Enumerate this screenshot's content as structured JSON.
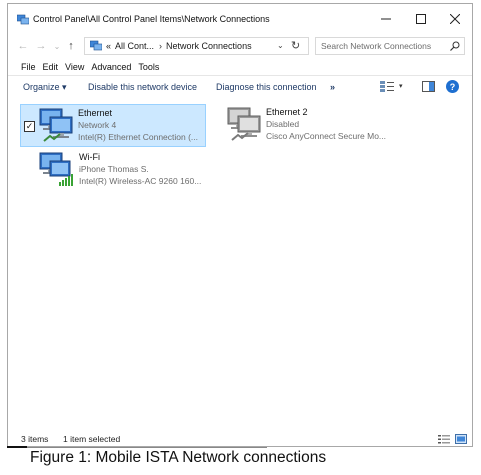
{
  "window": {
    "title": "Control Panel\\All Control Panel Items\\Network Connections",
    "controls": {
      "minimize": "─",
      "maximize": "☐",
      "close": "✕"
    }
  },
  "address": {
    "nav": {
      "back": "←",
      "forward": "→",
      "recent": "⌄",
      "up": "↑"
    },
    "crumb_overflow": "«",
    "crumbs": [
      "All Cont...",
      "Network Connections"
    ],
    "separator": "›",
    "dropdown": "⌄",
    "refresh": "↻"
  },
  "search": {
    "placeholder": "Search Network Connections"
  },
  "menu": {
    "items": [
      "File",
      "Edit",
      "View",
      "Advanced",
      "Tools"
    ]
  },
  "commands": {
    "organize": "Organize ▾",
    "disable": "Disable this network device",
    "diagnose": "Diagnose this connection",
    "more": "»",
    "view_chevron": "▾",
    "help": "?"
  },
  "connections": [
    {
      "name": "Ethernet",
      "status": "Network 4",
      "device": "Intel(R) Ethernet Connection (...",
      "selected": true,
      "checked": "✓"
    },
    {
      "name": "Ethernet 2",
      "status": "Disabled",
      "device": "Cisco AnyConnect Secure Mo...",
      "selected": false
    },
    {
      "name": "Wi-Fi",
      "status": "iPhone Thomas S.",
      "device": "Intel(R) Wireless-AC 9260 160...",
      "selected": false
    }
  ],
  "status": {
    "count": "3 items",
    "selected": "1 item selected"
  },
  "caption": "Figure 1: Mobile ISTA Network connections",
  "colors": {
    "selection_bg": "#cce8ff",
    "selection_border": "#99d1ff",
    "command_text": "#1f3a66",
    "help_blue": "#1e6fd0",
    "signal_green": "#3aa335"
  }
}
